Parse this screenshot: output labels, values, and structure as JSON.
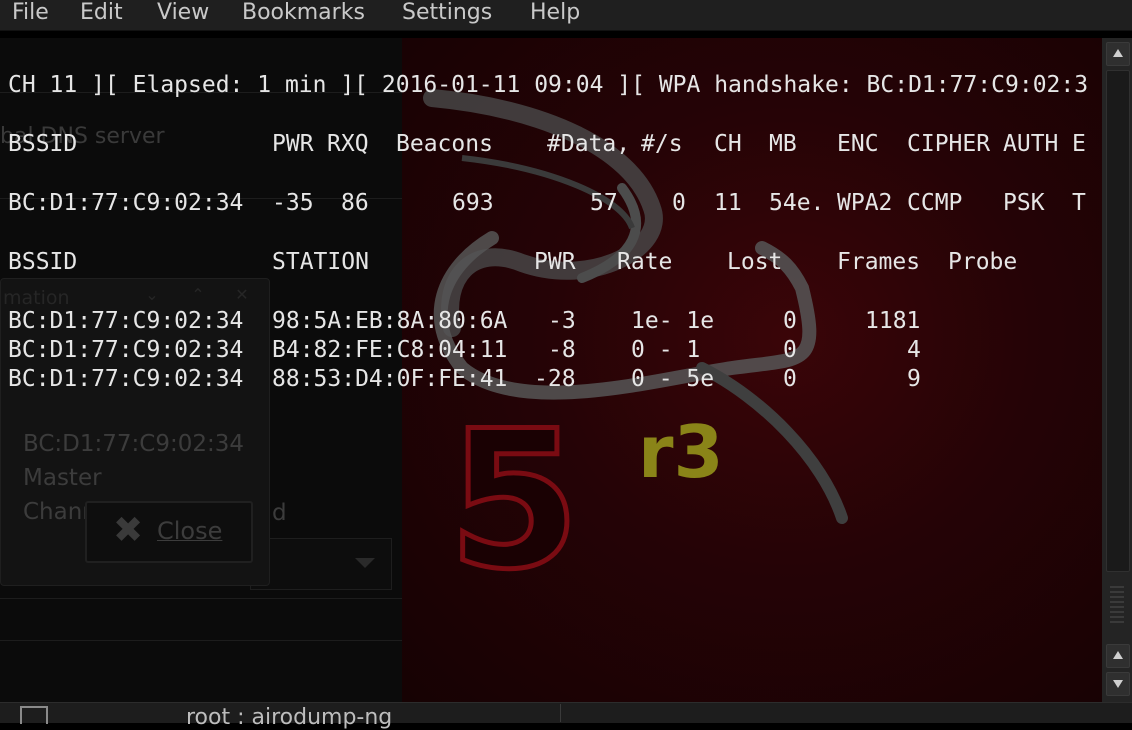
{
  "menubar": {
    "items": [
      "File",
      "Edit",
      "View",
      "Bookmarks",
      "Settings",
      "Help"
    ]
  },
  "terminal": {
    "status_line": "CH 11 ][ Elapsed: 1 min ][ 2016-01-11 09:04 ][ WPA handshake: BC:D1:77:C9:02:3",
    "ap_header": {
      "bssid": "BSSID",
      "pwr": "PWR",
      "rxq": "RXQ",
      "beacons": "Beacons",
      "data": "#Data,",
      "per_s": "#/s",
      "ch": "CH",
      "mb": "MB",
      "enc": "ENC",
      "cipher": "CIPHER",
      "auth": "AUTH",
      "essid": "E"
    },
    "ap_row": {
      "bssid": "BC:D1:77:C9:02:34",
      "pwr": "-35",
      "rxq": "86",
      "beacons": "693",
      "data": "57",
      "per_s": "0",
      "ch": "11",
      "mb": "54e.",
      "enc": "WPA2",
      "cipher": "CCMP",
      "auth": "PSK",
      "essid": "T"
    },
    "station_header": {
      "bssid": "BSSID",
      "station": "STATION",
      "pwr": "PWR",
      "rate": "Rate",
      "lost": "Lost",
      "frames": "Frames",
      "probe": "Probe"
    },
    "stations": [
      {
        "bssid": "BC:D1:77:C9:02:34",
        "station": "98:5A:EB:8A:80:6A",
        "pwr": "-3",
        "rate": "1e- 1e",
        "lost": "0",
        "frames": "1181"
      },
      {
        "bssid": "BC:D1:77:C9:02:34",
        "station": "B4:82:FE:C8:04:11",
        "pwr": "-8",
        "rate": "0 - 1",
        "lost": "0",
        "frames": "4"
      },
      {
        "bssid": "BC:D1:77:C9:02:34",
        "station": "88:53:D4:0F:FE:41",
        "pwr": "-28",
        "rate": "0 - 5e",
        "lost": "0",
        "frames": "9"
      }
    ]
  },
  "background_window": {
    "dns_label": "bal DNS server",
    "dialog": {
      "title": "mation",
      "line1": "BC:D1:77:C9:02:34",
      "line2": "Master",
      "line3": "Channel 11",
      "line3_suffix": "d",
      "close_label": "Close"
    }
  },
  "wallpaper": {
    "logo_number": "5",
    "logo_suffix": "r3"
  },
  "tabbar": {
    "title": "root : airodump-ng"
  },
  "colors": {
    "terminal_text": "#e6e6e6",
    "wallpaper_red": "#3a0508",
    "logo_yellow": "#8a8418",
    "menubar_bg": "#1f1f1f"
  }
}
